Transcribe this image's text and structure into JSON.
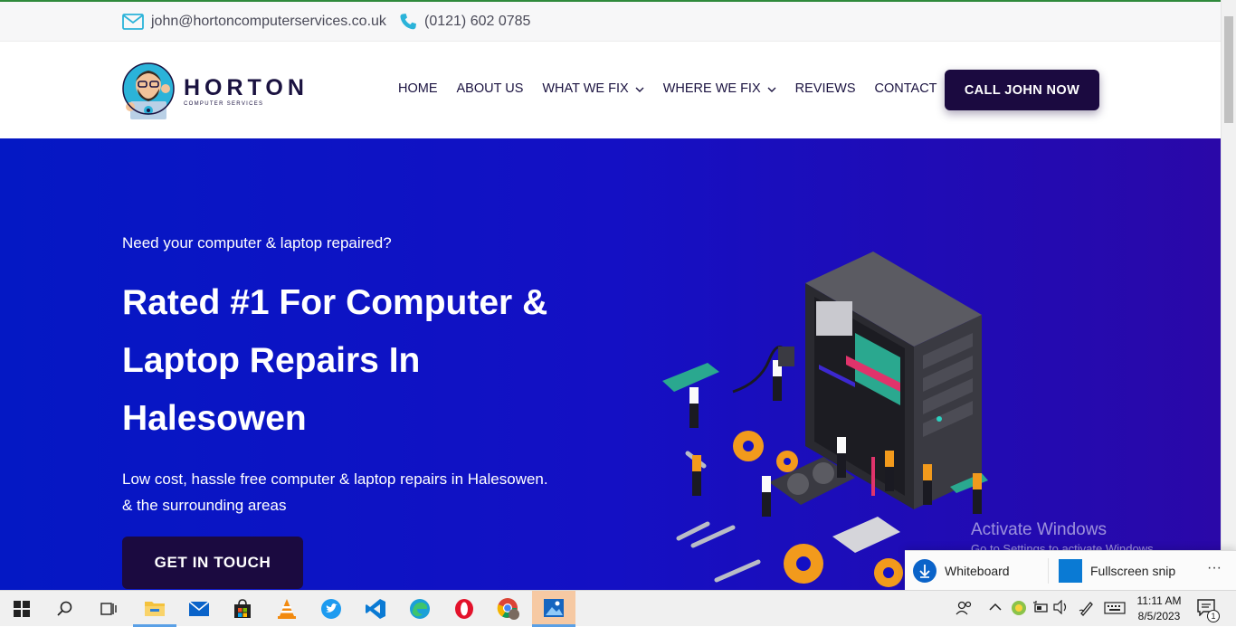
{
  "topbar": {
    "email": "john@hortoncomputerservices.co.uk",
    "phone": "(0121) 602 0785"
  },
  "logo": {
    "name": "HORTON",
    "tagline": "COMPUTER SERVICES"
  },
  "nav": {
    "items": [
      {
        "label": "HOME"
      },
      {
        "label": "ABOUT US"
      },
      {
        "label": "WHAT WE FIX",
        "dropdown": true
      },
      {
        "label": "WHERE WE FIX",
        "dropdown": true
      },
      {
        "label": "REVIEWS"
      },
      {
        "label": "CONTACT"
      }
    ],
    "cta": "CALL JOHN NOW"
  },
  "hero": {
    "subtitle": "Need your computer & laptop repaired?",
    "title_lines": [
      "Rated #1 For Computer &",
      "Laptop Repairs In",
      "Halesowen"
    ],
    "description_lines": [
      "Low cost, hassle free computer & laptop repairs in Halesowen.",
      "& the surrounding areas"
    ],
    "button": "GET IN TOUCH"
  },
  "watermark": {
    "title": "Activate Windows",
    "subtitle": "Go to Settings to activate Windows."
  },
  "suggestions": {
    "items": [
      "Whiteboard",
      "Fullscreen snip"
    ],
    "more": "···"
  },
  "taskbar": {
    "icons": [
      "windows-start-icon",
      "search-icon",
      "task-view-icon",
      "file-explorer-icon",
      "mail-icon",
      "store-icon",
      "vlc-icon",
      "twitter-icon",
      "vscode-icon",
      "edge-icon",
      "opera-icon",
      "chrome-icon",
      "photos-icon"
    ],
    "time": "11:11 AM",
    "date": "8/5/2023",
    "notification_count": "1"
  },
  "colors": {
    "brand_dark": "#1b0a40",
    "hero_blue": "#0418c4",
    "accent_cyan": "#2bb3d9"
  }
}
